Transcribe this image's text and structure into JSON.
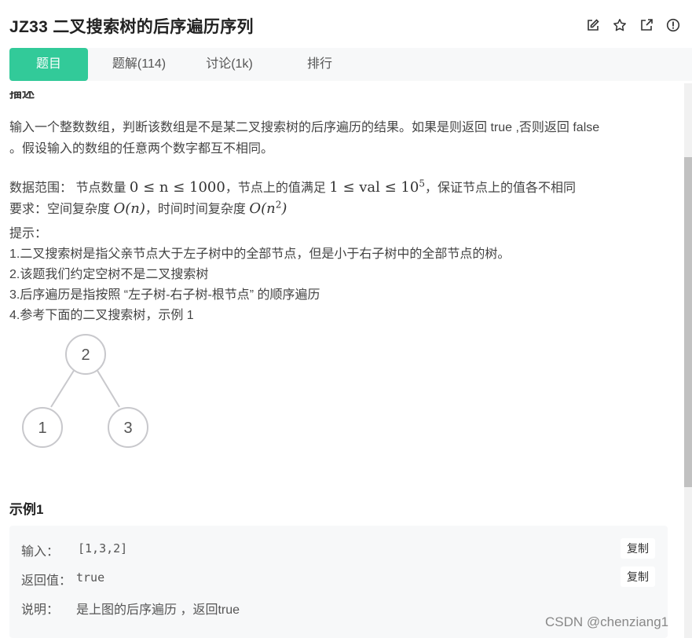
{
  "header": {
    "title": "JZ33  二叉搜索树的后序遍历序列",
    "icons": [
      "edit-icon",
      "star-icon",
      "external-link-icon",
      "info-icon"
    ]
  },
  "tabs": [
    {
      "label": "题目",
      "active": true
    },
    {
      "label": "题解(114)"
    },
    {
      "label": "讨论(1k)"
    },
    {
      "label": "排行"
    }
  ],
  "description": {
    "heading": "描述",
    "p1": "输入一个整数数组，判断该数组是不是某二叉搜索树的后序遍历的结果。如果是则返回 true ,否则返回 false",
    "p1b": "。假设输入的数组的任意两个数字都互不相同。",
    "range_prefix": "数据范围：  节点数量 ",
    "range_math1": "0 ≤ n ≤ 1000",
    "range_mid": "，节点上的值满足 ",
    "range_math2": "1 ≤ val ≤ 10",
    "range_sup": "5",
    "range_suffix": "，保证节点上的值各不相同",
    "req_prefix": "要求：空间复杂度 ",
    "req_math1": "O(n)",
    "req_mid": "，时间时间复杂度 ",
    "req_math2": "O(n",
    "req_sup": "2",
    "req_math2_end": ")",
    "hint": "提示：",
    "hints": [
      "1.二叉搜索树是指父亲节点大于左子树中的全部节点，但是小于右子树中的全部节点的树。",
      "2.该题我们约定空树不是二叉搜索树",
      "3.后序遍历是指按照 “左子树-右子树-根节点” 的顺序遍历",
      "4.参考下面的二叉搜索树，示例 1"
    ]
  },
  "tree": {
    "root": "2",
    "left": "1",
    "right": "3"
  },
  "example": {
    "heading": "示例1",
    "input_label": "输入：",
    "input_value": "[1,3,2]",
    "return_label": "返回值：",
    "return_value": "true",
    "explain_label": "说明：",
    "explain_value": "是上图的后序遍历  ，返回true",
    "copy_label": "复制"
  },
  "watermark": "CSDN @chenziang1"
}
